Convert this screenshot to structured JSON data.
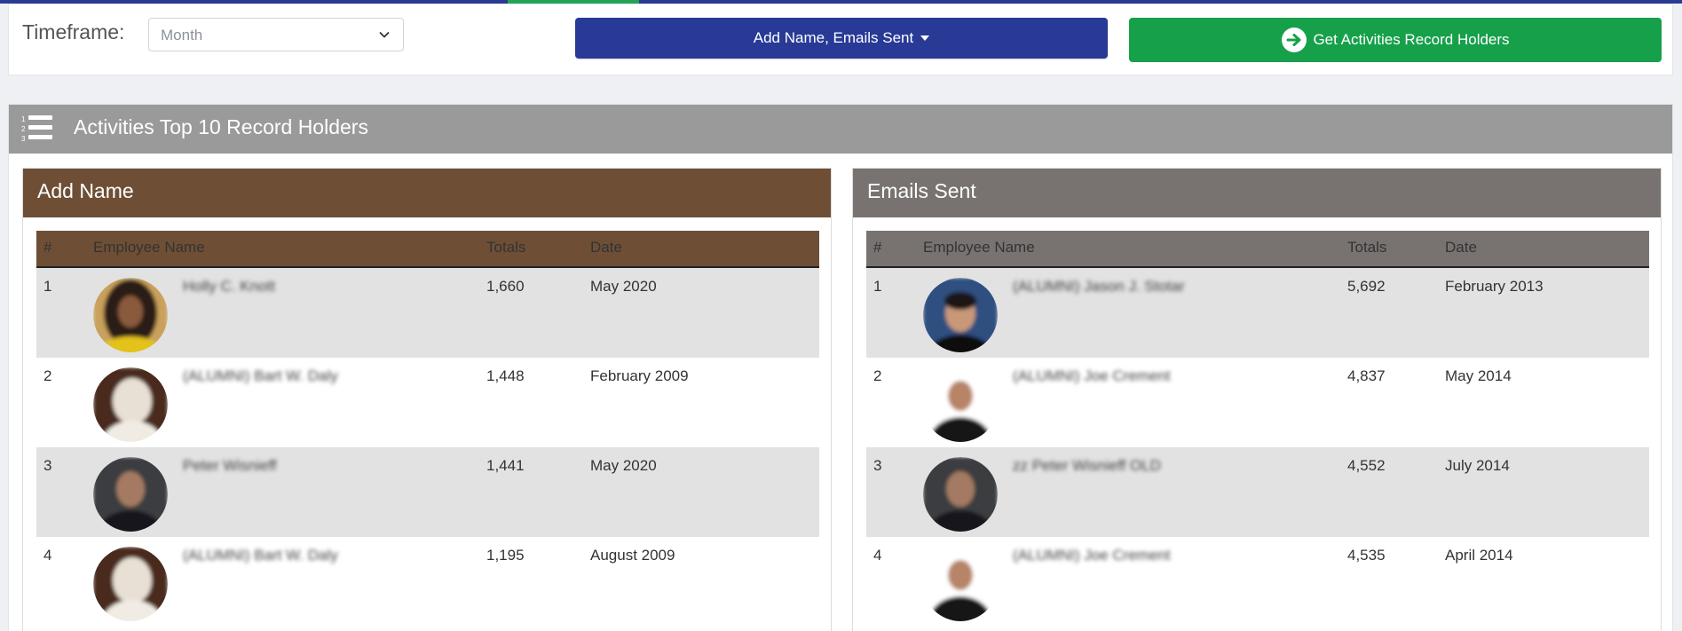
{
  "filters": {
    "timeframe_label": "Timeframe:",
    "timeframe_value": "Month",
    "activities_button": "Add Name, Emails Sent",
    "get_button": "Get Activities Record Holders"
  },
  "main": {
    "title": "Activities Top 10 Record Holders"
  },
  "columns": [
    "#",
    "Employee Name",
    "Totals",
    "Date"
  ],
  "left_panel": {
    "title": "Add Name",
    "rows": [
      {
        "rank": "1",
        "name": "Holly C. Knott",
        "total": "1,660",
        "date": "May 2020"
      },
      {
        "rank": "2",
        "name": "(ALUMNI) Bart W. Daly",
        "total": "1,448",
        "date": "February 2009"
      },
      {
        "rank": "3",
        "name": "Peter Wisnieff",
        "total": "1,441",
        "date": "May 2020"
      },
      {
        "rank": "4",
        "name": "(ALUMNI) Bart W. Daly",
        "total": "1,195",
        "date": "August 2009"
      }
    ]
  },
  "right_panel": {
    "title": "Emails Sent",
    "rows": [
      {
        "rank": "1",
        "name": "(ALUMNI) Jason J. Stotar",
        "total": "5,692",
        "date": "February 2013"
      },
      {
        "rank": "2",
        "name": "(ALUMNI) Joe Crement",
        "total": "4,837",
        "date": "May 2014"
      },
      {
        "rank": "3",
        "name": "zz Peter Wisnieff OLD",
        "total": "4,552",
        "date": "July 2014"
      },
      {
        "rank": "4",
        "name": "(ALUMNI) Joe Crement",
        "total": "4,535",
        "date": "April 2014"
      }
    ]
  },
  "colors": {
    "brand_blue": "#283a96",
    "brand_green": "#16a04a",
    "add_name_header": "#6e4f35",
    "emails_sent_header": "#787371",
    "section_header": "#9a9a9a"
  }
}
